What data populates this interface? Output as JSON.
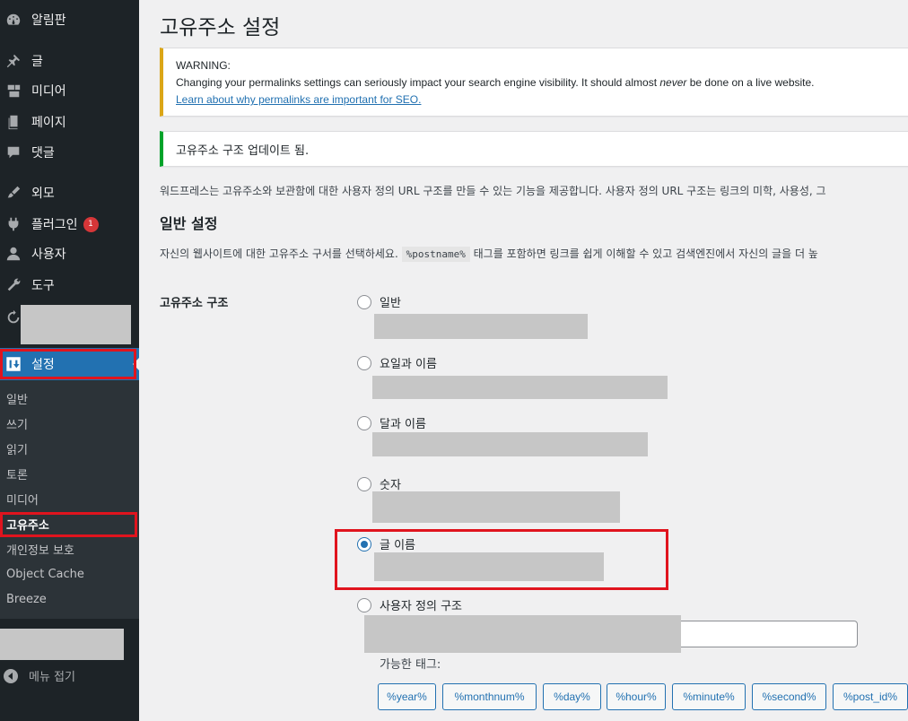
{
  "sidebar": {
    "items": [
      {
        "label": "알림판",
        "icon": "dashboard-icon"
      },
      {
        "label": "글",
        "icon": "pin-icon"
      },
      {
        "label": "미디어",
        "icon": "media-icon"
      },
      {
        "label": "페이지",
        "icon": "page-icon"
      },
      {
        "label": "댓글",
        "icon": "comment-icon"
      },
      {
        "label": "외모",
        "icon": "appearance-icon"
      },
      {
        "label": "플러그인",
        "icon": "plugin-icon",
        "badge": "1"
      },
      {
        "label": "사용자",
        "icon": "user-icon"
      },
      {
        "label": "도구",
        "icon": "wrench-icon"
      }
    ],
    "active": {
      "label": "설정",
      "icon": "settings-icon"
    },
    "submenu": [
      "일반",
      "쓰기",
      "읽기",
      "토론",
      "미디어",
      "고유주소",
      "개인정보 보호",
      "Object Cache",
      "Breeze"
    ],
    "current_submenu": "고유주소",
    "collapse_label": "메뉴 접기"
  },
  "page": {
    "title": "고유주소 설정",
    "warning": {
      "heading": "WARNING:",
      "text_before": "Changing your permalinks settings can seriously impact your search engine visibility. It should almost ",
      "text_em": "never",
      "text_after": " be done on a live website.",
      "link": "Learn about why permalinks are important for SEO."
    },
    "success": "고유주소 구조 업데이트 됨.",
    "intro": "워드프레스는 고유주소와 보관함에 대한 사용자 정의 URL 구조를 만들 수 있는 기능을 제공합니다. 사용자 정의 URL 구조는 링크의 미학, 사용성, 그",
    "section_title": "일반 설정",
    "section_desc_before": "자신의 웹사이트에 대한 고유주소 구서를 선택하세요. ",
    "section_desc_code": "%postname%",
    "section_desc_after": " 태그를 포함하면 링크를 쉽게 이해할 수 있고 검색엔진에서 자신의 글을 더 높",
    "structure_label": "고유주소 구조",
    "options": [
      {
        "label": "일반",
        "checked": false
      },
      {
        "label": "요일과 이름",
        "checked": false
      },
      {
        "label": "달과 이름",
        "checked": false
      },
      {
        "label": "숫자",
        "checked": false
      },
      {
        "label": "글 이름",
        "checked": true
      },
      {
        "label": "사용자 정의 구조",
        "checked": false
      }
    ],
    "available_tags_label": "가능한 태그:",
    "tags": [
      "%year%",
      "%monthnum%",
      "%day%",
      "%hour%",
      "%minute%",
      "%second%",
      "%post_id%"
    ]
  },
  "colors": {
    "sidebar_bg": "#1d2327",
    "submenu_bg": "#2c3338",
    "active_bg": "#2271b1",
    "highlight_box": "#e0141e",
    "warning_border": "#dba617",
    "success_border": "#00a32a"
  }
}
